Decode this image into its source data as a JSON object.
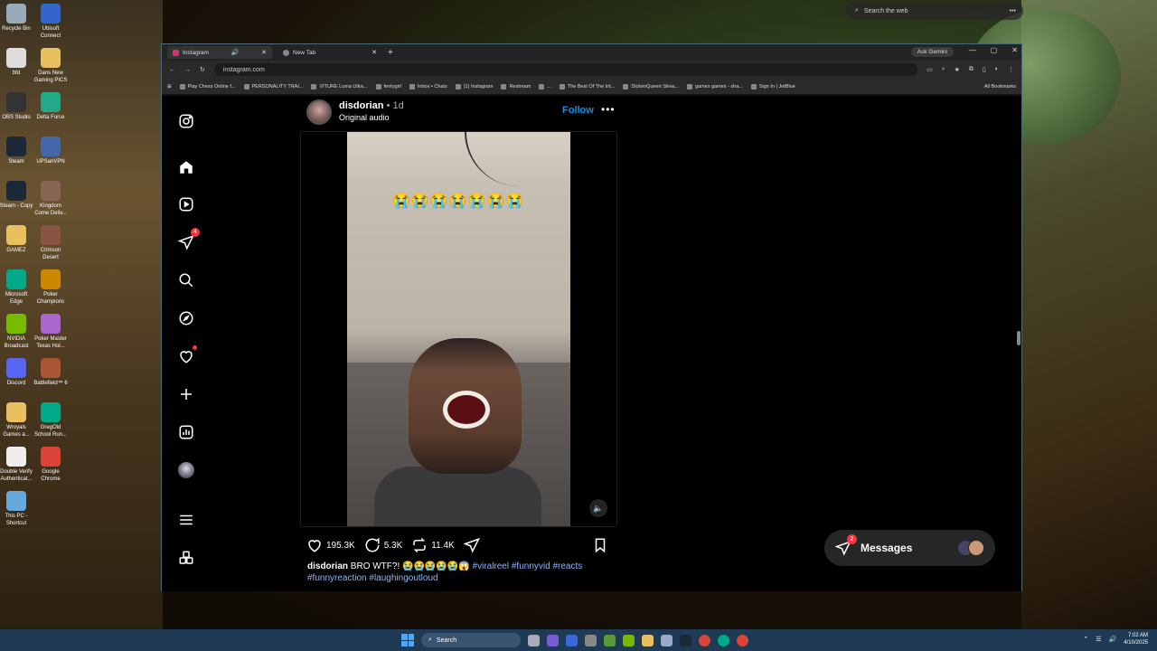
{
  "desktop": {
    "icons": [
      {
        "label": "Recycle Bin",
        "color": "#9ab"
      },
      {
        "label": "Ubisoft Connect",
        "color": "#36c"
      },
      {
        "label": "bfd",
        "color": "#ddd"
      },
      {
        "label": "Dans New Gaming PICS",
        "color": "#e8c060"
      },
      {
        "label": "OBS Studio",
        "color": "#333"
      },
      {
        "label": "Delta Force",
        "color": "#2a8"
      },
      {
        "label": "Steam",
        "color": "#1b2838"
      },
      {
        "label": "UPSanVPN",
        "color": "#46a"
      },
      {
        "label": "Steam - Copy",
        "color": "#1b2838"
      },
      {
        "label": "Kingdom Come Deliv...",
        "color": "#865"
      },
      {
        "label": "GAMEZ",
        "color": "#e8c060"
      },
      {
        "label": "Crimson Desert",
        "color": "#854"
      },
      {
        "label": "Microsoft Edge",
        "color": "#0a8"
      },
      {
        "label": "Poker Champions",
        "color": "#c80"
      },
      {
        "label": "NVIDIA Broadcast",
        "color": "#7b0"
      },
      {
        "label": "Poker Master Texas Hol...",
        "color": "#a6c"
      },
      {
        "label": "Discord",
        "color": "#5865f2"
      },
      {
        "label": "Battlefield™ 6",
        "color": "#a53"
      },
      {
        "label": "Wroyals Games a...",
        "color": "#e8c060"
      },
      {
        "label": "GregOld School Run...",
        "color": "#0a8"
      },
      {
        "label": "Double Verify Authenticat...",
        "color": "#eee"
      },
      {
        "label": "Google Chrome",
        "color": "#db4437"
      },
      {
        "label": "This PC - Shortcut",
        "color": "#6ad"
      }
    ]
  },
  "top_search": {
    "placeholder": "Search the web",
    "more": "•••"
  },
  "browser": {
    "tabs": [
      {
        "title": "Instagram",
        "active": true
      },
      {
        "title": "New Tab",
        "active": false
      }
    ],
    "new_tab": "+",
    "ask_gemini": "Ask Gemini",
    "url": "instagram.com",
    "bookmarks": [
      "Play Chess Online f...",
      "PERSONALITY TRAI...",
      "VITURE Luma Ultra...",
      "fentygirl",
      "Inbox • Chats",
      "(1) Instagram",
      "Restream",
      "...",
      "The Best Of The Int...",
      "DickenQueen Strea...",
      "games games - sha...",
      "Sign In | JetBlue"
    ],
    "all_bookmarks": "All Bookmarks"
  },
  "instagram": {
    "nav_badge": "4",
    "post": {
      "username": "disdorian",
      "time": "• 1d",
      "audio": "Original audio",
      "follow": "Follow",
      "more": "•••",
      "emoji_overlay": "😭😭😭😭😭😭😭",
      "likes": "195.3K",
      "comments": "5.3K",
      "reposts": "11.4K",
      "caption_user": "disdorian",
      "caption_text": "BRO WTF?! 😭😭😭😭😭😱",
      "caption_tags": "#viralreel #funnyvid #reacts #funnyreaction #laughingoutloud"
    },
    "messages": {
      "label": "Messages",
      "badge": "2"
    }
  },
  "taskbar": {
    "search": "Search",
    "time": "7:02 AM",
    "date": "4/10/2025"
  }
}
